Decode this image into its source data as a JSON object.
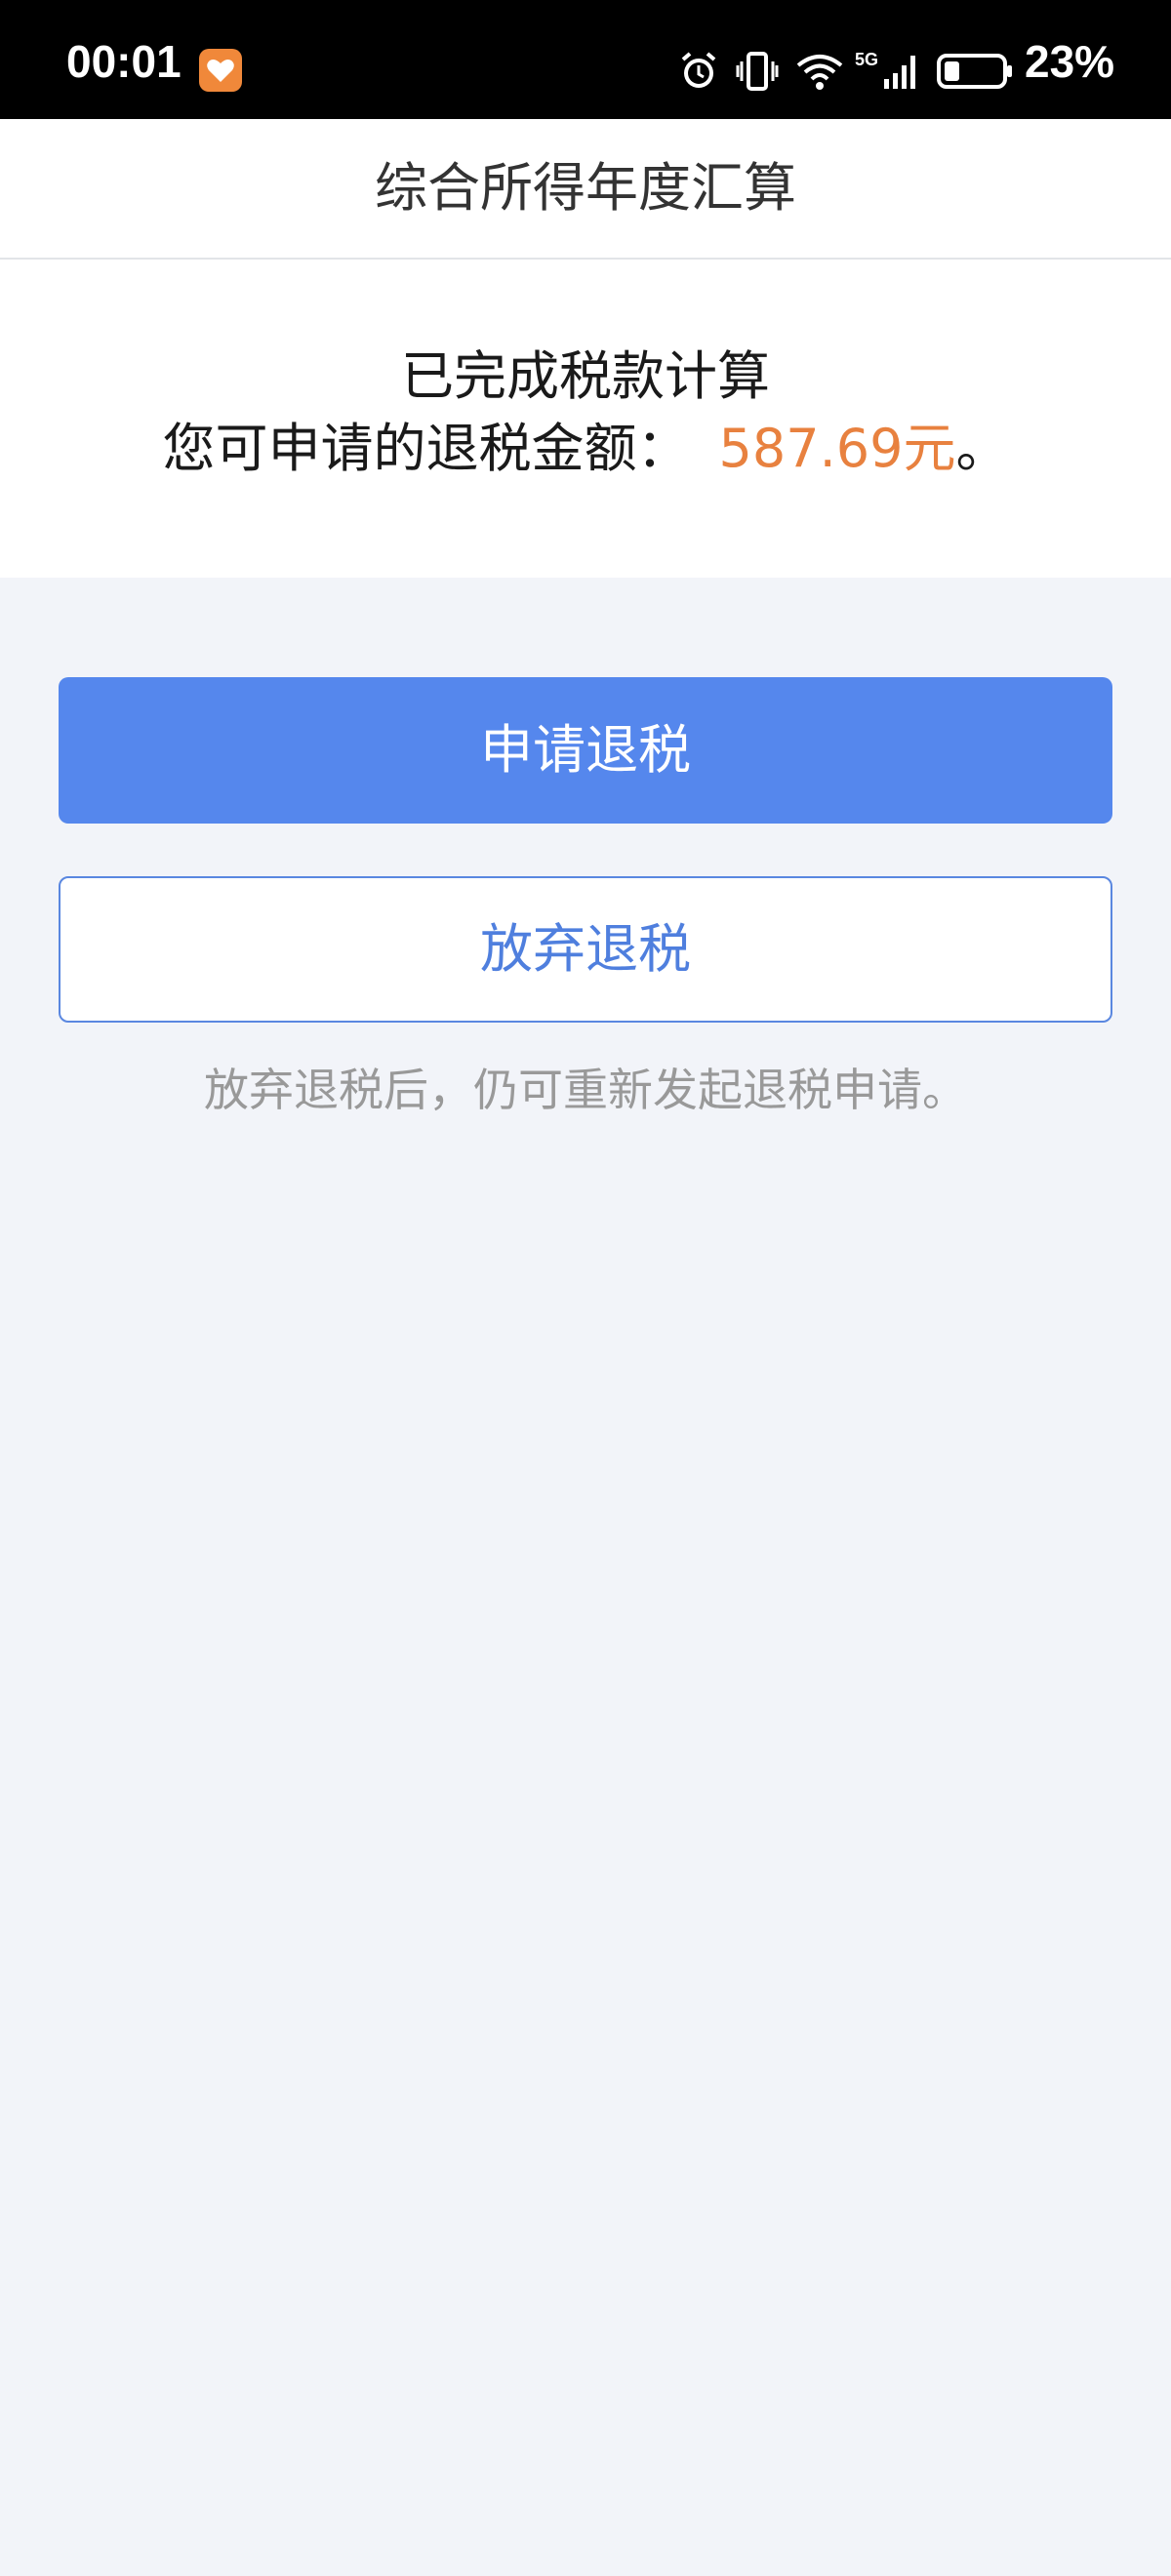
{
  "status_bar": {
    "time": "00:01",
    "battery": "23%",
    "icons": [
      "alarm-icon",
      "vibrate-icon",
      "wifi-icon",
      "signal-5g-icon",
      "battery-icon"
    ],
    "notification_app_color": "#f0883a"
  },
  "header": {
    "title": "综合所得年度汇算"
  },
  "result": {
    "line1": "已完成税款计算",
    "refund_label": "您可申请的退税金额：",
    "refund_amount": "587.69元",
    "refund_suffix": "。",
    "amount_color": "#e8813f"
  },
  "actions": {
    "apply_label": "申请退税",
    "abandon_label": "放弃退税",
    "primary_color": "#5587ed"
  },
  "hint": "放弃退税后，仍可重新发起退税申请。"
}
